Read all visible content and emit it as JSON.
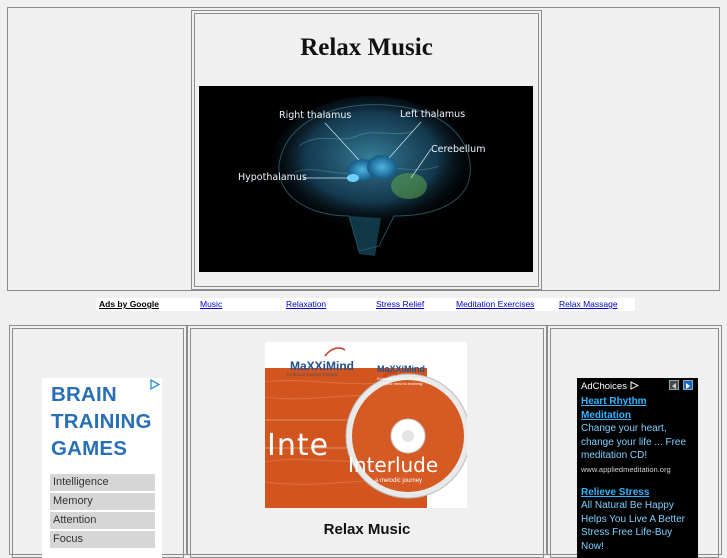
{
  "header": {
    "title": "Relax Music",
    "brain_labels": {
      "right_thalamus": "Right thalamus",
      "left_thalamus": "Left thalamus",
      "cerebellum": "Cerebellum",
      "hypothalamus": "Hypothalamus"
    }
  },
  "ad_links": {
    "ads_by": "Ads by Google",
    "links": [
      "Music",
      "Relaxation",
      "Stress Relief",
      "Meditation Exercises",
      "Relax Massage"
    ]
  },
  "left_ad": {
    "title_lines": [
      "BRAIN",
      "TRAINING",
      "GAMES"
    ],
    "menu": [
      "Intelligence",
      "Memory",
      "Attention",
      "Focus"
    ],
    "icon": "adchoices-play-icon"
  },
  "product": {
    "brand": "MaXXiMind",
    "tagline": "Embrace  Explore  Expand",
    "tagline_small": "your mind is evolving",
    "album_title_left": "Inte",
    "album_title": "Interlude",
    "album_subtitle": "a melodic journey",
    "caption": "Relax Music"
  },
  "right_ad": {
    "adchoices": "AdChoices",
    "items": [
      {
        "title": "Heart Rhythm Meditation",
        "text": "Change your heart, change your life ... Free meditation CD!",
        "url": "www.appliedmeditation.org"
      },
      {
        "title": "Relieve Stress",
        "text": "All Natural Be Happy Helps You Live A Better Stress Free Life-Buy Now!",
        "url": ""
      }
    ]
  },
  "colors": {
    "page_bg": "#f0f0f0",
    "link_blue": "#0000cc",
    "brain_training_blue": "#2a6fb4",
    "right_ad_link": "#33b4ff",
    "product_orange": "#d2541e"
  }
}
